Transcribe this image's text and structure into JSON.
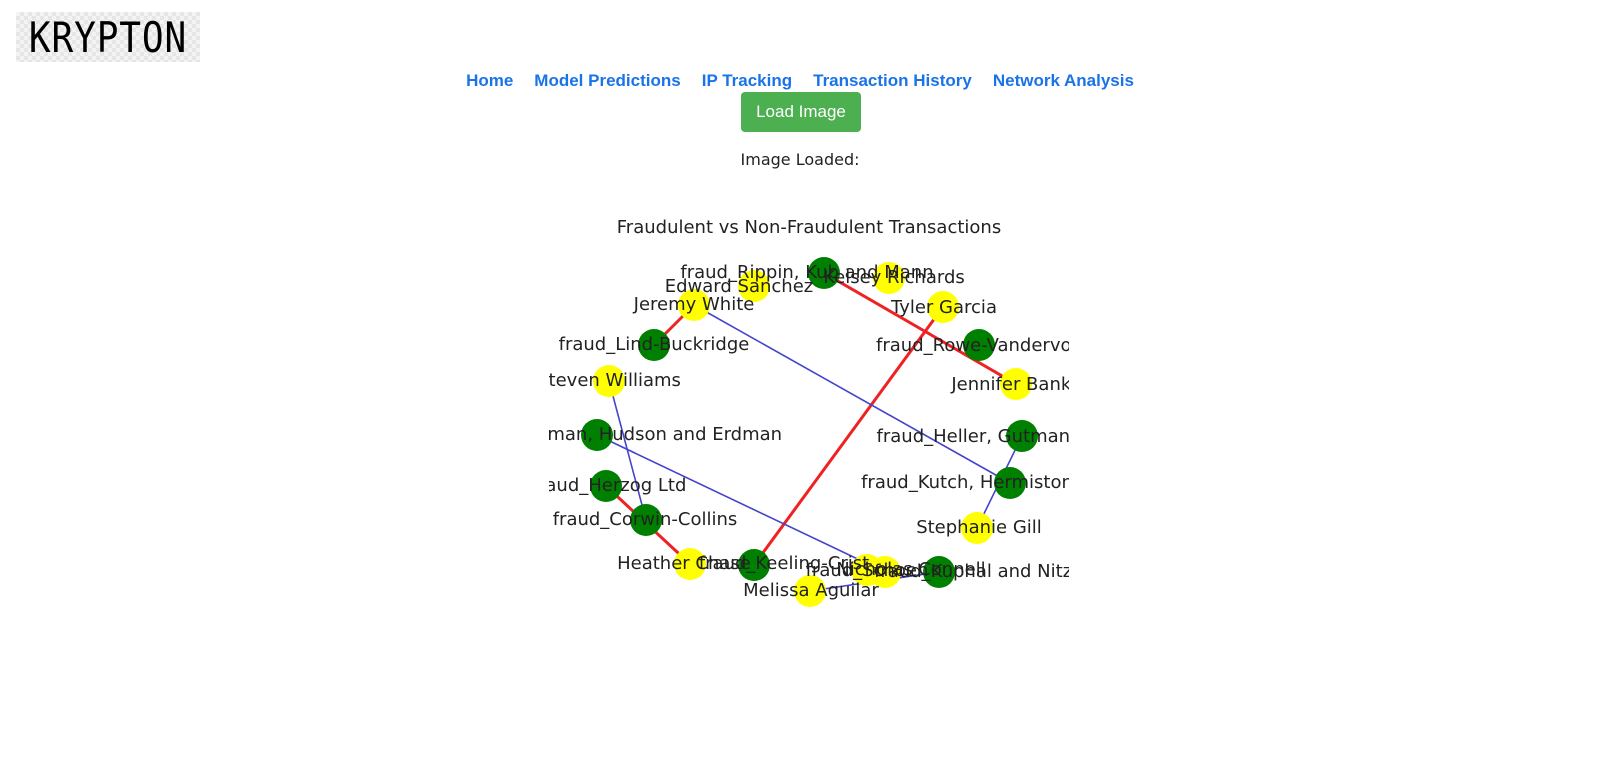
{
  "brand": {
    "logo_text": "KRYPTON"
  },
  "nav": {
    "items": [
      "Home",
      "Model Predictions",
      "IP Tracking",
      "Transaction History",
      "Network Analysis"
    ]
  },
  "actions": {
    "load_label": "Load Image"
  },
  "status": {
    "loaded_text": "Image Loaded:"
  },
  "figure": {
    "title": "Fraudulent vs Non-Fraudulent Transactions",
    "colors": {
      "merchant": "#008000",
      "customer": "#ffff00",
      "fraud_edge": "#ee2222",
      "normal_edge": "#4444cc"
    },
    "nodes": [
      {
        "id": "n_ripp",
        "label": "fraud_Rippin, Kub and Mann",
        "kind": "merchant"
      },
      {
        "id": "n_kelsey",
        "label": "Kelsey Richards",
        "kind": "customer"
      },
      {
        "id": "n_tyler",
        "label": "Tyler Garcia",
        "kind": "customer"
      },
      {
        "id": "n_rowe",
        "label": "fraud_Rowe-Vandervort",
        "kind": "merchant"
      },
      {
        "id": "n_jenn",
        "label": "Jennifer Banks",
        "kind": "customer"
      },
      {
        "id": "n_heller",
        "label": "fraud_Heller, Gutmann",
        "kind": "merchant"
      },
      {
        "id": "n_kutch",
        "label": "fraud_Kutch, Hermiston",
        "kind": "merchant"
      },
      {
        "id": "n_steph",
        "label": "Stephanie Gill",
        "kind": "customer"
      },
      {
        "id": "n_kuphal",
        "label": "fraud_Kuphal and Nitzsche",
        "kind": "merchant"
      },
      {
        "id": "n_schoen",
        "label": "fraud_Schoen",
        "kind": "customer"
      },
      {
        "id": "n_connell",
        "label": "Nicholas Connell",
        "kind": "customer"
      },
      {
        "id": "n_melissa",
        "label": "Melissa Aguilar",
        "kind": "customer"
      },
      {
        "id": "n_keel",
        "label": "fraud_Keeling-Crist",
        "kind": "merchant"
      },
      {
        "id": "n_heath",
        "label": "Heather Chase",
        "kind": "customer"
      },
      {
        "id": "n_corwin",
        "label": "fraud_Corwin-Collins",
        "kind": "merchant"
      },
      {
        "id": "n_herzog",
        "label": "fraud_Herzog Ltd",
        "kind": "merchant"
      },
      {
        "id": "n_hudson",
        "label": "fraud_Bauman, Hudson and Erdman",
        "kind": "merchant"
      },
      {
        "id": "n_steven",
        "label": "Steven Williams",
        "kind": "customer"
      },
      {
        "id": "n_lind",
        "label": "fraud_Lind-Buckridge",
        "kind": "merchant"
      },
      {
        "id": "n_jeremy",
        "label": "Jeremy White",
        "kind": "customer"
      },
      {
        "id": "n_edward",
        "label": "Edward Sanchez",
        "kind": "customer"
      }
    ],
    "edges": [
      {
        "from": "n_ripp",
        "to": "n_jenn",
        "fraud": true
      },
      {
        "from": "n_tyler",
        "to": "n_keel",
        "fraud": true
      },
      {
        "from": "n_jeremy",
        "to": "n_lind",
        "fraud": true
      },
      {
        "from": "n_herzog",
        "to": "n_heath",
        "fraud": true
      },
      {
        "from": "n_jeremy",
        "to": "n_kutch",
        "fraud": false
      },
      {
        "from": "n_heller",
        "to": "n_steph",
        "fraud": false
      },
      {
        "from": "n_steven",
        "to": "n_corwin",
        "fraud": false
      },
      {
        "from": "n_hudson",
        "to": "n_connell",
        "fraud": false
      },
      {
        "from": "n_melissa",
        "to": "n_kuphal",
        "fraud": false
      }
    ]
  }
}
